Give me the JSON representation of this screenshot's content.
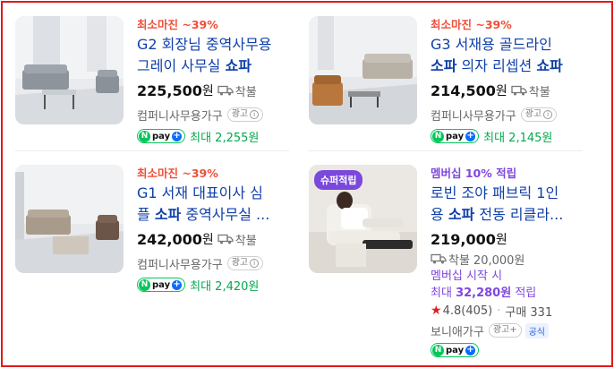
{
  "products": [
    {
      "promo": "최소마진 ~39%",
      "title_line1": "G2 회장님 중역사무용",
      "title_line2_plain": "그레이 사무실 ",
      "title_line2_bold": "쇼파",
      "price": "225,500",
      "currency": "원",
      "shipping": "착불",
      "seller": "컴퍼니사무용가구",
      "ad_label": "광고",
      "ad_info_icon": "i",
      "npay_label": "pay",
      "npay_max": "최대 2,255원"
    },
    {
      "promo": "최소마진 ~39%",
      "title_line1": "G3 서재용 골드라인",
      "title_line2_bold1": "소파",
      "title_line2_plain": " 의자 리셉션 ",
      "title_line2_bold2": "쇼파",
      "price": "214,500",
      "currency": "원",
      "shipping": "착불",
      "seller": "컴퍼니사무용가구",
      "ad_label": "광고",
      "ad_info_icon": "i",
      "npay_label": "pay",
      "npay_max": "최대 2,145원"
    },
    {
      "promo": "최소마진 ~39%",
      "title_line1": "G1 서재 대표이사 심",
      "title_line2_plain1": "플 ",
      "title_line2_bold": "소파",
      "title_line2_plain2": " 중역사무실 ...",
      "price": "242,000",
      "currency": "원",
      "shipping": "착불",
      "seller": "컴퍼니사무용가구",
      "ad_label": "광고",
      "ad_info_icon": "i",
      "npay_label": "pay",
      "npay_max": "최대 2,420원"
    },
    {
      "badge": "슈퍼적립",
      "promo": "멤버십 10% 적립",
      "title_line1": "로빈 조야 패브릭 1인",
      "title_line2_plain1": "용 ",
      "title_line2_bold": "소파",
      "title_line2_plain2": " 전동 리클라...",
      "price": "219,000",
      "currency": "원",
      "shipping": "착불",
      "shipping_fee": "20,000원",
      "member_start": "멤버십 시작 시",
      "member_max_prefix": "최대 ",
      "member_max_amount": "32,280원",
      "member_max_suffix": " 적립",
      "rating": "4.8",
      "reviews": "(405)",
      "purchase_label": "구매 331",
      "seller": "보니애가구",
      "ad_label": "광고+",
      "official_tag": "공식",
      "npay_label": "pay"
    }
  ],
  "colors": {
    "frame": "#e21a1a",
    "promo": "#ef4e38",
    "member": "#7f47dd",
    "title": "#0f3fa8",
    "npay_green": "#03c75a",
    "star": "#e02020"
  }
}
